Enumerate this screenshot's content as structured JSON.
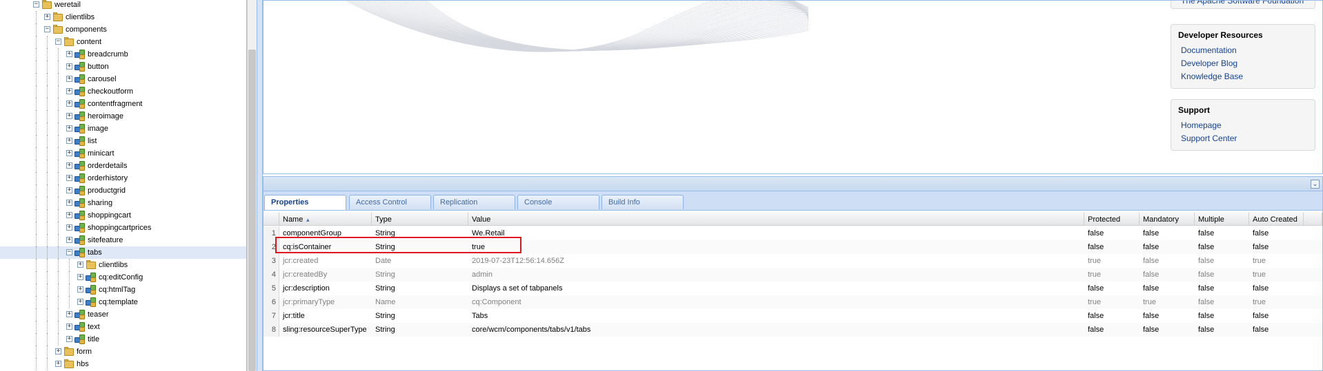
{
  "tree": {
    "rows": [
      {
        "label": "weretail",
        "level": 2,
        "type": "folder",
        "toggle": "−"
      },
      {
        "label": "clientlibs",
        "level": 3,
        "type": "folder",
        "toggle": "+"
      },
      {
        "label": "components",
        "level": 3,
        "type": "folder",
        "toggle": "−"
      },
      {
        "label": "content",
        "level": 4,
        "type": "folder",
        "toggle": "−"
      },
      {
        "label": "breadcrumb",
        "level": 5,
        "type": "component",
        "toggle": "+"
      },
      {
        "label": "button",
        "level": 5,
        "type": "component",
        "toggle": "+"
      },
      {
        "label": "carousel",
        "level": 5,
        "type": "component",
        "toggle": "+"
      },
      {
        "label": "checkoutform",
        "level": 5,
        "type": "component",
        "toggle": "+"
      },
      {
        "label": "contentfragment",
        "level": 5,
        "type": "component",
        "toggle": "+"
      },
      {
        "label": "heroimage",
        "level": 5,
        "type": "component",
        "toggle": "+"
      },
      {
        "label": "image",
        "level": 5,
        "type": "component",
        "toggle": "+"
      },
      {
        "label": "list",
        "level": 5,
        "type": "component",
        "toggle": "+"
      },
      {
        "label": "minicart",
        "level": 5,
        "type": "component",
        "toggle": "+"
      },
      {
        "label": "orderdetails",
        "level": 5,
        "type": "component",
        "toggle": "+"
      },
      {
        "label": "orderhistory",
        "level": 5,
        "type": "component",
        "toggle": "+"
      },
      {
        "label": "productgrid",
        "level": 5,
        "type": "component",
        "toggle": "+"
      },
      {
        "label": "sharing",
        "level": 5,
        "type": "component",
        "toggle": "+"
      },
      {
        "label": "shoppingcart",
        "level": 5,
        "type": "component",
        "toggle": "+"
      },
      {
        "label": "shoppingcartprices",
        "level": 5,
        "type": "component",
        "toggle": "+"
      },
      {
        "label": "sitefeature",
        "level": 5,
        "type": "component",
        "toggle": "+"
      },
      {
        "label": "tabs",
        "level": 5,
        "type": "component",
        "toggle": "−",
        "selected": true
      },
      {
        "label": "clientlibs",
        "level": 6,
        "type": "folder",
        "toggle": "+"
      },
      {
        "label": "cq:editConfig",
        "level": 6,
        "type": "component",
        "toggle": "+"
      },
      {
        "label": "cq:htmlTag",
        "level": 6,
        "type": "component",
        "toggle": "+"
      },
      {
        "label": "cq:template",
        "level": 6,
        "type": "component",
        "toggle": "+"
      },
      {
        "label": "teaser",
        "level": 5,
        "type": "component",
        "toggle": "+"
      },
      {
        "label": "text",
        "level": 5,
        "type": "component",
        "toggle": "+"
      },
      {
        "label": "title",
        "level": 5,
        "type": "component",
        "toggle": "+"
      },
      {
        "label": "form",
        "level": 4,
        "type": "folder",
        "toggle": "+"
      },
      {
        "label": "hbs",
        "level": 4,
        "type": "folder",
        "toggle": "+"
      }
    ]
  },
  "top_panel": {
    "foundation_link": "The Apache Software Foundation",
    "developer_resources": {
      "title": "Developer Resources",
      "links": [
        "Documentation",
        "Developer Blog",
        "Knowledge Base"
      ]
    },
    "support": {
      "title": "Support",
      "links": [
        "Homepage",
        "Support Center"
      ]
    }
  },
  "tabs": [
    "Properties",
    "Access Control",
    "Replication",
    "Console",
    "Build Info"
  ],
  "active_tab": 0,
  "grid": {
    "columns": [
      "Name",
      "Type",
      "Value",
      "Protected",
      "Mandatory",
      "Multiple",
      "Auto Created"
    ],
    "sort_column": "Name",
    "rows": [
      {
        "num": "1",
        "name": "componentGroup",
        "type": "String",
        "value": "We.Retail",
        "protected": "false",
        "mandatory": "false",
        "multiple": "false",
        "auto_created": "false",
        "muted": false
      },
      {
        "num": "2",
        "name": "cq:isContainer",
        "type": "String",
        "value": "true",
        "protected": "false",
        "mandatory": "false",
        "multiple": "false",
        "auto_created": "false",
        "muted": false
      },
      {
        "num": "3",
        "name": "jcr:created",
        "type": "Date",
        "value": "2019-07-23T12:56:14.656Z",
        "protected": "true",
        "mandatory": "false",
        "multiple": "false",
        "auto_created": "true",
        "muted": true
      },
      {
        "num": "4",
        "name": "jcr:createdBy",
        "type": "String",
        "value": "admin",
        "protected": "true",
        "mandatory": "false",
        "multiple": "false",
        "auto_created": "true",
        "muted": true
      },
      {
        "num": "5",
        "name": "jcr:description",
        "type": "String",
        "value": "Displays a set of tabpanels",
        "protected": "false",
        "mandatory": "false",
        "multiple": "false",
        "auto_created": "false",
        "muted": false
      },
      {
        "num": "6",
        "name": "jcr:primaryType",
        "type": "Name",
        "value": "cq:Component",
        "protected": "true",
        "mandatory": "true",
        "multiple": "false",
        "auto_created": "true",
        "muted": true
      },
      {
        "num": "7",
        "name": "jcr:title",
        "type": "String",
        "value": "Tabs",
        "protected": "false",
        "mandatory": "false",
        "multiple": "false",
        "auto_created": "false",
        "muted": false
      },
      {
        "num": "8",
        "name": "sling:resourceSuperType",
        "type": "String",
        "value": "core/wcm/components/tabs/v1/tabs",
        "protected": "false",
        "mandatory": "false",
        "multiple": "false",
        "auto_created": "false",
        "muted": false
      }
    ]
  },
  "icons": {
    "folder": "folder-icon",
    "component": "component-icon",
    "collapse": "double-chevron-down-icon"
  },
  "colors": {
    "panel_border": "#99bbe8",
    "selection": "#dfe8f6",
    "highlight": "#e3161d",
    "link": "#15428b"
  }
}
